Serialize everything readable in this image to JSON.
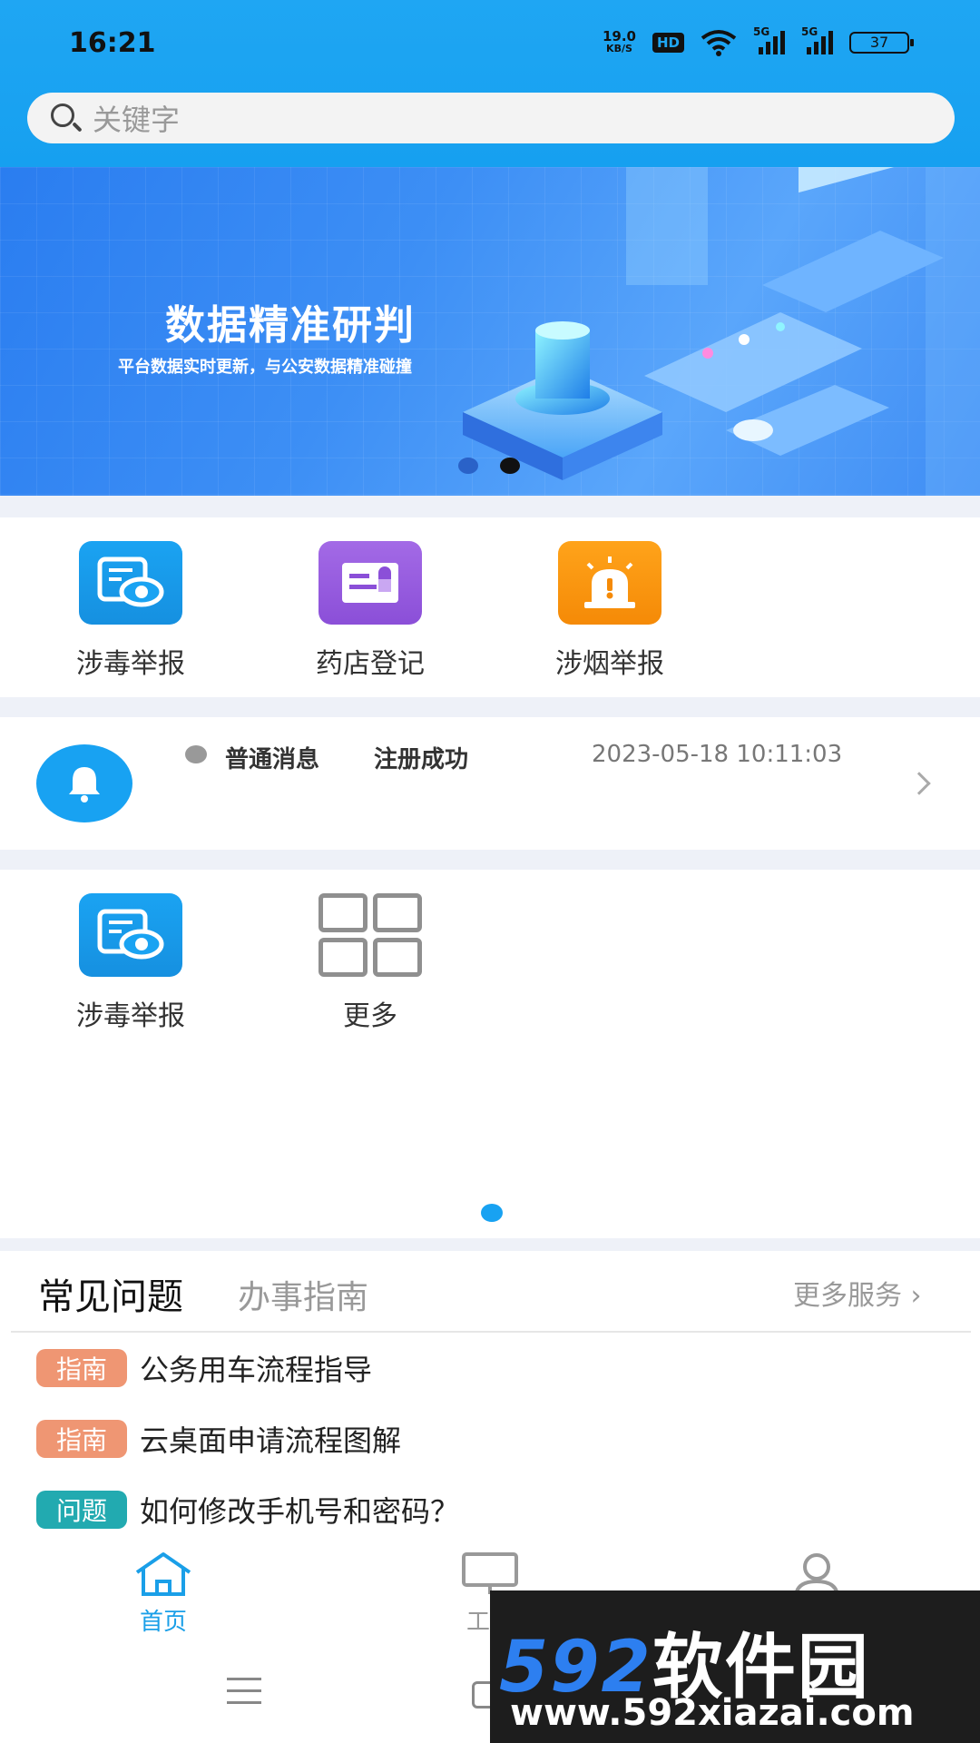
{
  "status_bar": {
    "time": "16:21",
    "net_speed_value": "19.0",
    "net_speed_unit": "KB/S",
    "hd": "HD",
    "signal_label_1": "5G",
    "signal_label_2": "5G",
    "battery": "37"
  },
  "search": {
    "placeholder": "关键字"
  },
  "banner": {
    "title": "数据精准研判",
    "subtitle": "平台数据实时更新，与公安数据精准碰撞",
    "active_dot_index": 1,
    "dot_count": 2
  },
  "services": [
    {
      "label": "涉毒举报",
      "icon": "report-eye-icon",
      "color": "#1aa3f2"
    },
    {
      "label": "药店登记",
      "icon": "pharmacy-card-icon",
      "color": "#9b5fe0"
    },
    {
      "label": "涉烟举报",
      "icon": "alarm-light-icon",
      "color": "#f7900c"
    }
  ],
  "notice": {
    "icon": "bell-icon",
    "type": "普通消息",
    "title": "注册成功",
    "time": "2023-05-18 10:11:03"
  },
  "apps": [
    {
      "label": "涉毒举报",
      "icon": "report-eye-icon"
    },
    {
      "label": "更多",
      "icon": "grid-more-icon"
    }
  ],
  "faq": {
    "tab_active": "常见问题",
    "tab_other": "办事指南",
    "more": "更多服务",
    "items": [
      {
        "tag": "指南",
        "tag_color": "#ef9673",
        "text": "公务用车流程指导"
      },
      {
        "tag": "指南",
        "tag_color": "#ef9673",
        "text": "云桌面申请流程图解"
      },
      {
        "tag": "问题",
        "tag_color": "#22aab0",
        "text": "如何修改手机号和密码？"
      }
    ]
  },
  "bottom_nav": {
    "home": "首页",
    "work": "工作",
    "active_color": "#1a9fe8",
    "inactive_color": "#999999"
  },
  "watermark": {
    "logo_digits": "592",
    "logo_text": "软件园",
    "url": "www.592xiazai.com"
  }
}
